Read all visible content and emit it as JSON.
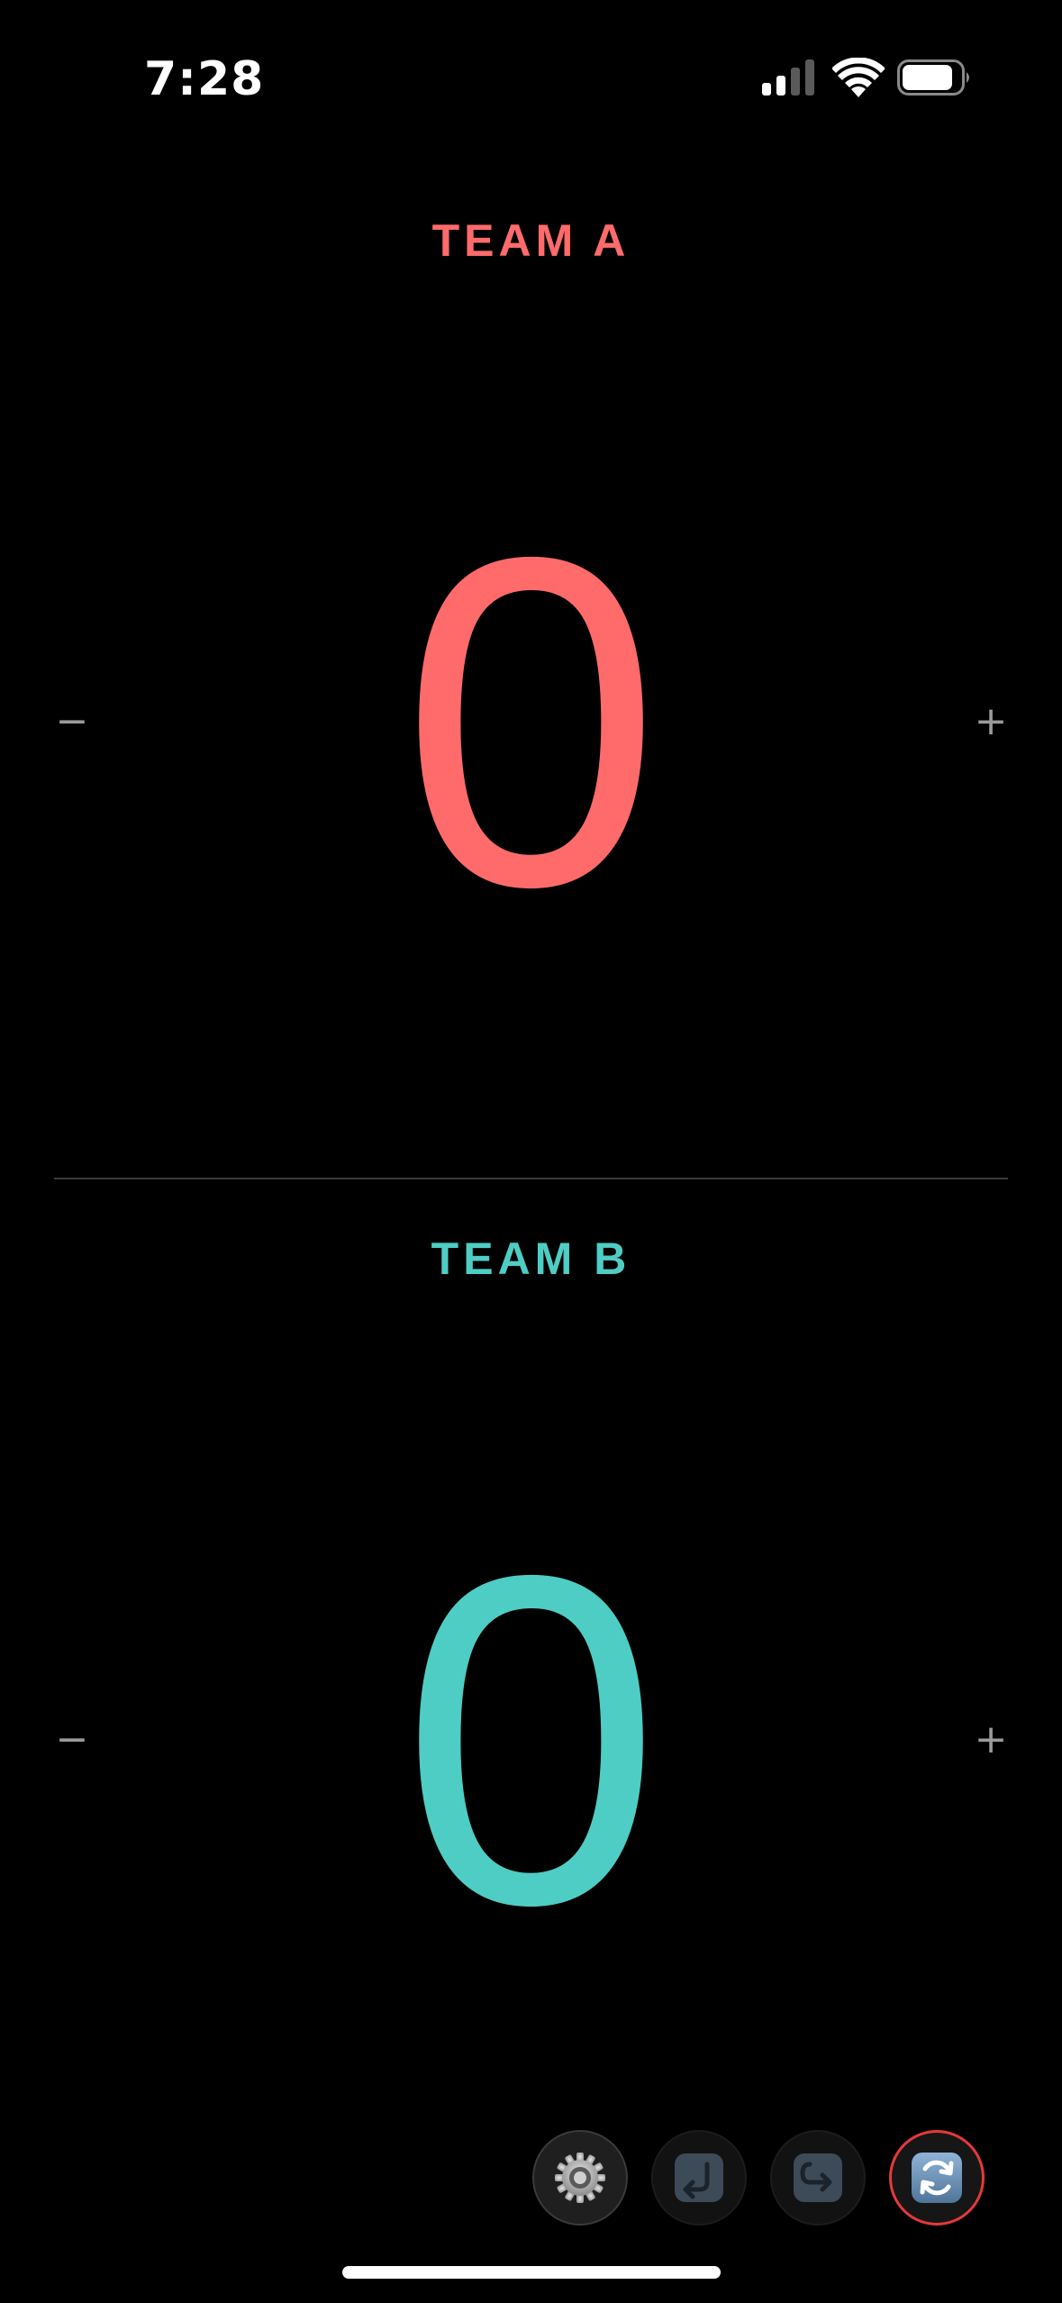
{
  "status_bar": {
    "time": "7:28"
  },
  "team_a": {
    "name": "TEAM A",
    "score": "0",
    "color": "#ff6b6b",
    "minus_symbol": "−",
    "plus_symbol": "+"
  },
  "team_b": {
    "name": "TEAM B",
    "score": "0",
    "color": "#4ecdc4",
    "minus_symbol": "−",
    "plus_symbol": "+"
  },
  "toolbar": {
    "buttons": [
      {
        "name": "settings",
        "icon": "gear-icon"
      },
      {
        "name": "undo",
        "icon": "undo-icon"
      },
      {
        "name": "redo",
        "icon": "redo-icon"
      },
      {
        "name": "reset",
        "icon": "refresh-icon",
        "accent": "#e5393a"
      }
    ]
  }
}
